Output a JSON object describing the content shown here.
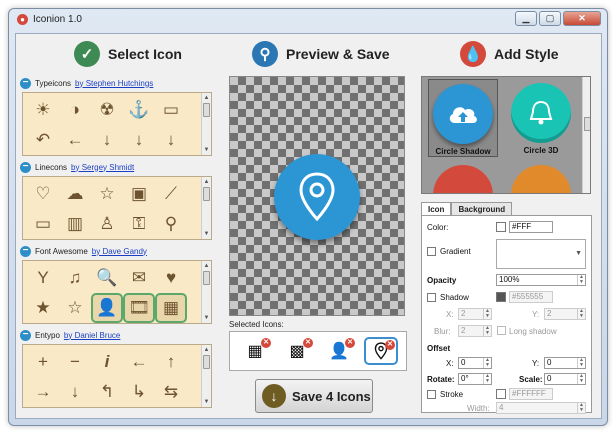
{
  "window": {
    "title": "Iconion 1.0"
  },
  "select_icon": {
    "heading": "Select Icon",
    "sets": [
      {
        "name": "Typeicons",
        "author": "by Stephen Hutchings",
        "icons": [
          "☀",
          "◑",
          "☢",
          "⚓",
          "▭",
          "↶",
          "←",
          "↓",
          "↓",
          "↓"
        ]
      },
      {
        "name": "Linecons",
        "author": "by Sergey Shmidt",
        "icons": [
          "♡",
          "☁",
          "☆",
          "▣",
          "⟋",
          "▭",
          "▥",
          "♙",
          "⚿",
          "⚲"
        ]
      },
      {
        "name": "Font Awesome",
        "author": "by Dave Gandy",
        "icons": [
          "Y",
          "♫",
          "🔍",
          "✉",
          "♥",
          "★",
          "☆",
          "👤",
          "🎞",
          "▦"
        ]
      },
      {
        "name": "Entypo",
        "author": "by Daniel Bruce",
        "icons": [
          "+",
          "−",
          "i",
          "←",
          "↑",
          "→",
          "↓",
          "↰",
          "↳",
          "⇆"
        ]
      }
    ]
  },
  "preview": {
    "heading": "Preview & Save",
    "selected_label": "Selected Icons:",
    "save_label": "Save 4 Icons"
  },
  "add_style": {
    "heading": "Add Style",
    "styles": [
      {
        "name": "Circle Shadow",
        "color": "#2c96d4"
      },
      {
        "name": "Circle 3D",
        "color": "#1ac4b4"
      }
    ],
    "tabs": [
      "Icon",
      "Background"
    ],
    "props": {
      "color_label": "Color:",
      "color_value": "#FFF",
      "gradient_label": "Gradient",
      "opacity_label": "Opacity",
      "opacity_value": "100%",
      "shadow_label": "Shadow",
      "shadow_value": "#555555",
      "x_label": "X:",
      "shadow_x": "2",
      "y_label": "Y:",
      "shadow_y": "2",
      "blur_label": "Blur:",
      "blur_value": "2",
      "long_shadow_label": "Long shadow",
      "offset_label": "Offset",
      "offset_x": "0",
      "offset_y": "0",
      "rotate_label": "Rotate:",
      "rotate_value": "0°",
      "scale_label": "Scale:",
      "scale_value": "0",
      "stroke_label": "Stroke",
      "stroke_value": "#FFFFFF",
      "width_label": "Width:",
      "width_value": "4"
    }
  },
  "colors": {
    "accent": "#2c96d4",
    "icon_tile_bg": "#f9e9c6",
    "icon_brown": "#6e5330"
  }
}
